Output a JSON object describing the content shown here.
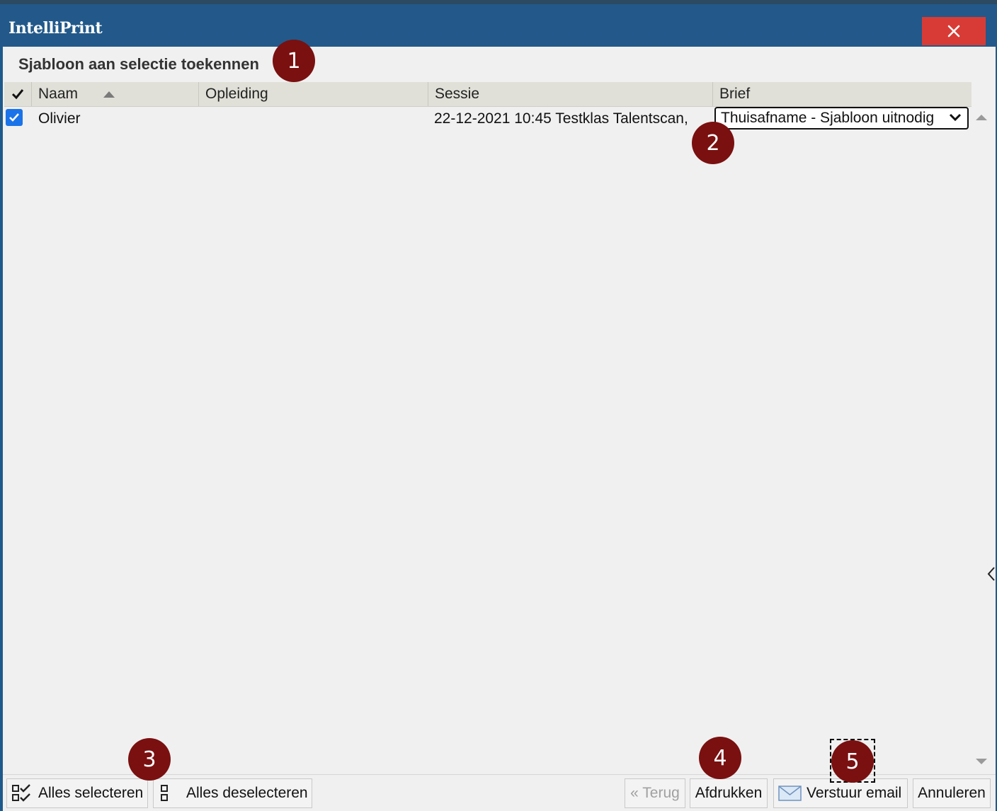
{
  "window": {
    "title": "IntelliPrint"
  },
  "panel": {
    "caption": "Sjabloon aan selectie toekennen"
  },
  "table": {
    "columns": [
      "Naam",
      "Opleiding",
      "Sessie",
      "Brief"
    ],
    "sort_column": "Naam",
    "rows": [
      {
        "checked": true,
        "naam": "Olivier",
        "opleiding": "",
        "sessie": "22-12-2021 10:45 Testklas Talentscan,",
        "brief": "Thuisafname - Sjabloon uitnodig"
      }
    ]
  },
  "buttons": {
    "select_all": "Alles selecteren",
    "deselect_all": "Alles deselecteren",
    "back": "« Terug",
    "print": "Afdrukken",
    "send_email": "Verstuur email",
    "cancel": "Annuleren"
  },
  "markers": [
    "1",
    "2",
    "3",
    "4",
    "5"
  ],
  "colors": {
    "titlebar": "#22598a",
    "close": "#d83b35",
    "marker": "#7a1010",
    "checkbox": "#1a73e8"
  }
}
